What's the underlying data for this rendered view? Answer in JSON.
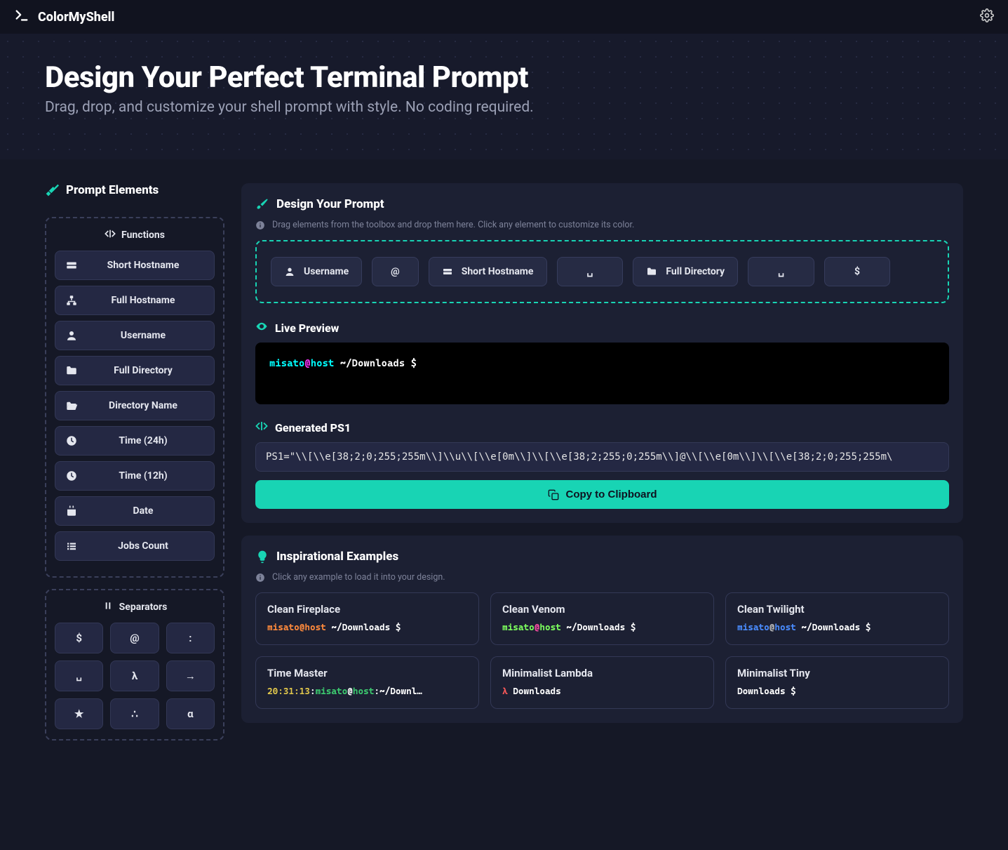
{
  "nav": {
    "brand": "ColorMyShell"
  },
  "hero": {
    "title": "Design Your Perfect Terminal Prompt",
    "subtitle": "Drag, drop, and customize your shell prompt with style. No coding required."
  },
  "sidebar": {
    "title": "Prompt Elements",
    "functions_heading": "Functions",
    "functions": [
      {
        "icon": "server-icon",
        "label": "Short Hostname"
      },
      {
        "icon": "network-icon",
        "label": "Full Hostname"
      },
      {
        "icon": "user-icon",
        "label": "Username"
      },
      {
        "icon": "folder-icon",
        "label": "Full Directory"
      },
      {
        "icon": "folder-open-icon",
        "label": "Directory Name"
      },
      {
        "icon": "clock-icon",
        "label": "Time (24h)"
      },
      {
        "icon": "clock-icon",
        "label": "Time (12h)"
      },
      {
        "icon": "calendar-icon",
        "label": "Date"
      },
      {
        "icon": "list-icon",
        "label": "Jobs Count"
      }
    ],
    "separators_heading": "Separators",
    "separators": [
      "$",
      "@",
      ":",
      "␣",
      "λ",
      "→",
      "★",
      "∴",
      "α"
    ]
  },
  "design": {
    "title": "Design Your Prompt",
    "hint": "Drag elements from the toolbox and drop them here. Click any element to customize its color.",
    "chips": [
      {
        "icon": "user-icon",
        "label": "Username",
        "cls": ""
      },
      {
        "icon": "",
        "label": "@",
        "cls": "narrow"
      },
      {
        "icon": "server-icon",
        "label": "Short Hostname",
        "cls": ""
      },
      {
        "icon": "",
        "label": "␣",
        "cls": "tiny"
      },
      {
        "icon": "folder-icon",
        "label": "Full Directory",
        "cls": ""
      },
      {
        "icon": "",
        "label": "␣",
        "cls": "tiny"
      },
      {
        "icon": "",
        "label": "$",
        "cls": "tiny"
      }
    ]
  },
  "preview": {
    "title": "Live Preview",
    "segments": [
      {
        "text": "misato",
        "cls": "c-cyan"
      },
      {
        "text": "@",
        "cls": "c-mag"
      },
      {
        "text": "host",
        "cls": "c-cyan"
      },
      {
        "text": " ~/Downloads ",
        "cls": "c-white"
      },
      {
        "text": "$",
        "cls": "c-white"
      }
    ]
  },
  "ps1": {
    "title": "Generated PS1",
    "value": "PS1=\"\\\\[\\\\e[38;2;0;255;255m\\\\]\\\\u\\\\[\\\\e[0m\\\\]\\\\[\\\\e[38;2;255;0;255m\\\\]@\\\\[\\\\e[0m\\\\]\\\\[\\\\e[38;2;0;255;255m\\",
    "copy_label": "Copy to Clipboard"
  },
  "examples": {
    "title": "Inspirational Examples",
    "hint": "Click any example to load it into your design.",
    "items": [
      {
        "name": "Clean Fireplace",
        "segments": [
          {
            "text": "misato",
            "cls": "c-orange"
          },
          {
            "text": "@",
            "cls": "c-orange"
          },
          {
            "text": "host",
            "cls": "c-orange"
          },
          {
            "text": " ~/Downloads ",
            "cls": "c-white"
          },
          {
            "text": "$",
            "cls": "c-white"
          }
        ]
      },
      {
        "name": "Clean Venom",
        "segments": [
          {
            "text": "misato",
            "cls": "c-green2"
          },
          {
            "text": "@",
            "cls": "c-pink"
          },
          {
            "text": "host",
            "cls": "c-green2"
          },
          {
            "text": " ~/Downloads ",
            "cls": "c-white"
          },
          {
            "text": "$",
            "cls": "c-white"
          }
        ]
      },
      {
        "name": "Clean Twilight",
        "segments": [
          {
            "text": "misato",
            "cls": "c-blue"
          },
          {
            "text": "@",
            "cls": "c-grey"
          },
          {
            "text": "host",
            "cls": "c-blue"
          },
          {
            "text": " ~/Downloads ",
            "cls": "c-white"
          },
          {
            "text": "$",
            "cls": "c-white"
          }
        ]
      },
      {
        "name": "Time Master",
        "segments": [
          {
            "text": "20:31:13",
            "cls": "c-yellow"
          },
          {
            "text": ":",
            "cls": "c-white"
          },
          {
            "text": "misato",
            "cls": "c-green"
          },
          {
            "text": "@",
            "cls": "c-white"
          },
          {
            "text": "host",
            "cls": "c-green"
          },
          {
            "text": ":",
            "cls": "c-white"
          },
          {
            "text": "~/Downl…",
            "cls": "c-white"
          }
        ]
      },
      {
        "name": "Minimalist Lambda",
        "segments": [
          {
            "text": "λ ",
            "cls": "c-red"
          },
          {
            "text": "Downloads",
            "cls": "c-white"
          }
        ]
      },
      {
        "name": "Minimalist Tiny",
        "segments": [
          {
            "text": "Downloads ",
            "cls": "c-white"
          },
          {
            "text": "$",
            "cls": "c-white"
          }
        ]
      }
    ]
  }
}
